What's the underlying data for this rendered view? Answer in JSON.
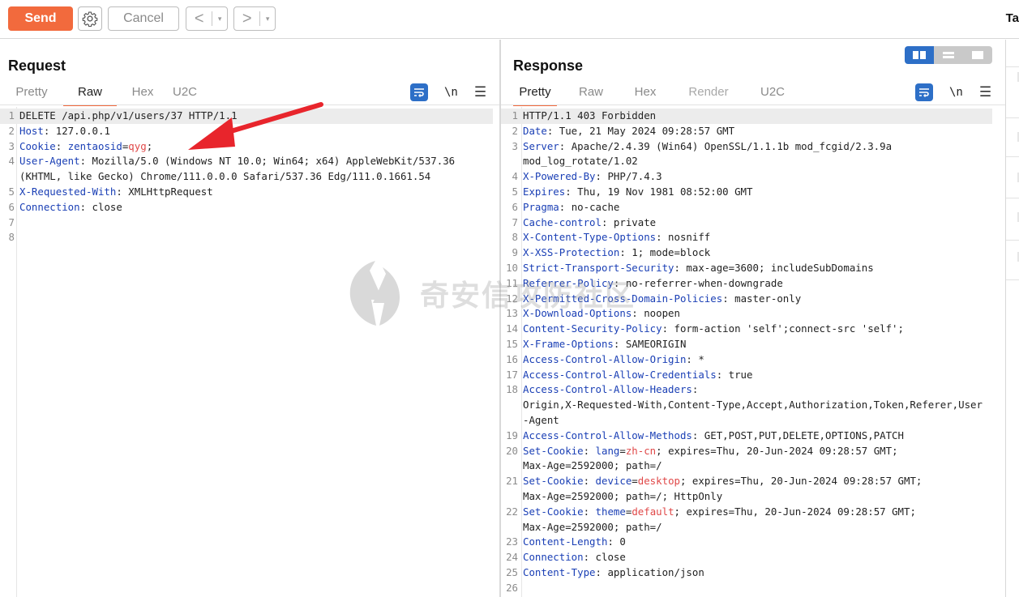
{
  "toolbar": {
    "send_label": "Send",
    "cancel_label": "Cancel",
    "back_label": "<",
    "forward_label": ">",
    "dropdown_glyph": "▾",
    "tab_partial": "Ta"
  },
  "colors": {
    "accent": "#f26a3d",
    "key": "#1a3fb5",
    "cookie_value": "#e04848",
    "toggle_active": "#2d6fc7"
  },
  "request": {
    "title": "Request",
    "tabs": [
      {
        "label": "Pretty",
        "active": false
      },
      {
        "label": "Raw",
        "active": true
      },
      {
        "label": "Hex",
        "active": false
      },
      {
        "label": "U2C",
        "active": false
      }
    ],
    "newline_label": "\\n",
    "lines": [
      {
        "n": "1",
        "text": "DELETE /api.php/v1/users/37 HTTP/1.1"
      },
      {
        "n": "2",
        "key": "Host",
        "value": "127.0.0.1"
      },
      {
        "n": "3",
        "key": "Cookie",
        "ck": "zentaosid",
        "cv": "qyg",
        "tail": ";"
      },
      {
        "n": "4",
        "key": "User-Agent",
        "value": "Mozilla/5.0 (Windows NT 10.0; Win64; x64) AppleWebKit/537.36"
      },
      {
        "n": "",
        "text": "(KHTML, like Gecko) Chrome/111.0.0.0 Safari/537.36 Edg/111.0.1661.54"
      },
      {
        "n": "5",
        "key": "X-Requested-With",
        "value": "XMLHttpRequest"
      },
      {
        "n": "6",
        "key": "Connection",
        "value": "close"
      },
      {
        "n": "7",
        "text": ""
      },
      {
        "n": "8",
        "text": ""
      }
    ]
  },
  "response": {
    "title": "Response",
    "tabs": [
      {
        "label": "Pretty",
        "active": true
      },
      {
        "label": "Raw",
        "active": false
      },
      {
        "label": "Hex",
        "active": false
      },
      {
        "label": "Render",
        "active": false,
        "disabled": true
      },
      {
        "label": "U2C",
        "active": false
      }
    ],
    "newline_label": "\\n",
    "lines": [
      {
        "n": "1",
        "text": "HTTP/1.1 403 Forbidden"
      },
      {
        "n": "2",
        "key": "Date",
        "value": "Tue, 21 May 2024 09:28:57 GMT"
      },
      {
        "n": "3",
        "key": "Server",
        "value": "Apache/2.4.39 (Win64) OpenSSL/1.1.1b mod_fcgid/2.3.9a"
      },
      {
        "n": "",
        "text": "mod_log_rotate/1.02"
      },
      {
        "n": "4",
        "key": "X-Powered-By",
        "value": "PHP/7.4.3"
      },
      {
        "n": "5",
        "key": "Expires",
        "value": "Thu, 19 Nov 1981 08:52:00 GMT"
      },
      {
        "n": "6",
        "key": "Pragma",
        "value": "no-cache"
      },
      {
        "n": "7",
        "key": "Cache-control",
        "value": "private"
      },
      {
        "n": "8",
        "key": "X-Content-Type-Options",
        "value": "nosniff"
      },
      {
        "n": "9",
        "key": "X-XSS-Protection",
        "value": "1; mode=block"
      },
      {
        "n": "10",
        "key": "Strict-Transport-Security",
        "value": "max-age=3600; includeSubDomains"
      },
      {
        "n": "11",
        "key": "Referrer-Policy",
        "value": "no-referrer-when-downgrade"
      },
      {
        "n": "12",
        "key": "X-Permitted-Cross-Domain-Policies",
        "value": "master-only"
      },
      {
        "n": "13",
        "key": "X-Download-Options",
        "value": "noopen"
      },
      {
        "n": "14",
        "key": "Content-Security-Policy",
        "value": "form-action 'self';connect-src 'self';"
      },
      {
        "n": "15",
        "key": "X-Frame-Options",
        "value": "SAMEORIGIN"
      },
      {
        "n": "16",
        "key": "Access-Control-Allow-Origin",
        "value": "*"
      },
      {
        "n": "17",
        "key": "Access-Control-Allow-Credentials",
        "value": "true"
      },
      {
        "n": "18",
        "key": "Access-Control-Allow-Headers",
        "value": ""
      },
      {
        "n": "",
        "text": "Origin,X-Requested-With,Content-Type,Accept,Authorization,Token,Referer,User"
      },
      {
        "n": "",
        "text": "-Agent"
      },
      {
        "n": "19",
        "key": "Access-Control-Allow-Methods",
        "value": "GET,POST,PUT,DELETE,OPTIONS,PATCH"
      },
      {
        "n": "20",
        "key": "Set-Cookie",
        "ck": "lang",
        "cv": "zh-cn",
        "tail": "; expires=Thu, 20-Jun-2024 09:28:57 GMT;"
      },
      {
        "n": "",
        "text": "Max-Age=2592000; path=/"
      },
      {
        "n": "21",
        "key": "Set-Cookie",
        "ck": "device",
        "cv": "desktop",
        "tail": "; expires=Thu, 20-Jun-2024 09:28:57 GMT;"
      },
      {
        "n": "",
        "text": "Max-Age=2592000; path=/; HttpOnly"
      },
      {
        "n": "22",
        "key": "Set-Cookie",
        "ck": "theme",
        "cv": "default",
        "tail": "; expires=Thu, 20-Jun-2024 09:28:57 GMT;"
      },
      {
        "n": "",
        "text": "Max-Age=2592000; path=/"
      },
      {
        "n": "23",
        "key": "Content-Length",
        "value": "0"
      },
      {
        "n": "24",
        "key": "Connection",
        "value": "close"
      },
      {
        "n": "25",
        "key": "Content-Type",
        "value": "application/json"
      },
      {
        "n": "26",
        "text": ""
      }
    ]
  },
  "watermark": {
    "text": "奇安信攻防社区"
  }
}
